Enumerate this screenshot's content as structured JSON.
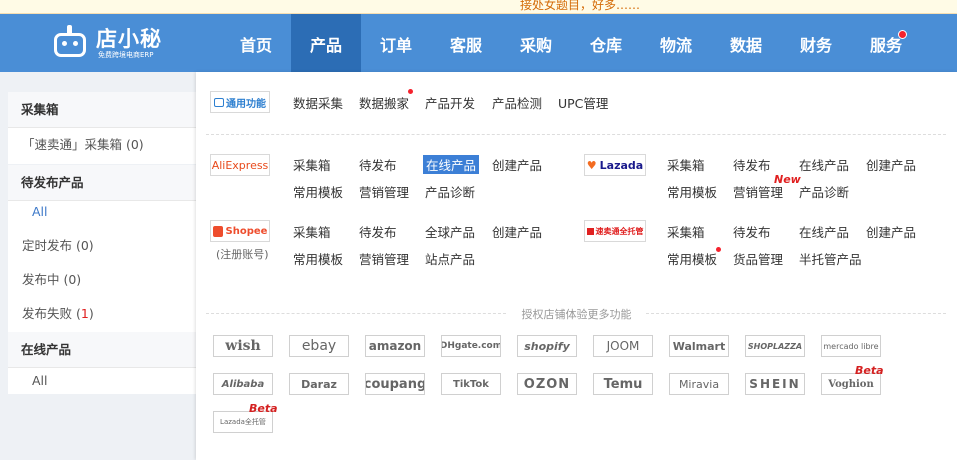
{
  "notice_text": "接处女题目，好多……",
  "brand": {
    "name": "店小秘",
    "tagline": "免费跨境电商ERP"
  },
  "nav": [
    {
      "label": "首页"
    },
    {
      "label": "产品",
      "active": true
    },
    {
      "label": "订单"
    },
    {
      "label": "客服"
    },
    {
      "label": "采购"
    },
    {
      "label": "仓库"
    },
    {
      "label": "物流"
    },
    {
      "label": "数据"
    },
    {
      "label": "财务"
    },
    {
      "label": "服务",
      "dot": true
    }
  ],
  "sidebar": {
    "collect": {
      "title": "采集箱",
      "rows": [
        "「速卖通」采集箱 (0)"
      ]
    },
    "pending": {
      "title": "待发布产品",
      "all": "All",
      "scheduled": "定时发布 (0)",
      "publishing": "发布中 (0)",
      "failed_prefix": "发布失败 (",
      "failed_count": "1",
      "failed_suffix": ")"
    },
    "online": {
      "title": "在线产品",
      "all": "All"
    }
  },
  "general": {
    "badge": "通用功能",
    "links": [
      "数据采集",
      "数据搬家",
      "产品开发",
      "产品检测",
      "UPC管理"
    ]
  },
  "aliexpress": {
    "badge": "AliExpress",
    "row1": [
      "采集箱",
      "待发布",
      "在线产品",
      "创建产品"
    ],
    "row2": [
      "常用模板",
      "营销管理",
      "产品诊断"
    ]
  },
  "lazada": {
    "badge": "Lazada",
    "row1": [
      "采集箱",
      "待发布",
      "在线产品",
      "创建产品"
    ],
    "row2": [
      "常用模板",
      "营销管理",
      "产品诊断"
    ],
    "new_tag": "New"
  },
  "shopee": {
    "badge": "Shopee",
    "register": "(注册账号)",
    "row1": [
      "采集箱",
      "待发布",
      "全球产品",
      "创建产品"
    ],
    "row2": [
      "常用模板",
      "营销管理",
      "站点产品"
    ]
  },
  "aliexpress_choice": {
    "badge": "速卖通全托管",
    "row1": [
      "采集箱",
      "待发布",
      "在线产品",
      "创建产品"
    ],
    "row2": [
      "常用模板",
      "货品管理",
      "半托管产品"
    ]
  },
  "more_title": "授权店铺体验更多功能",
  "platforms": [
    "wish",
    "ebay",
    "amazon",
    "DHgate.com",
    "shopify",
    "JOOM",
    "Walmart",
    "SHOPLAZZA",
    "mercado libre",
    "Alibaba",
    "Daraz",
    "coupang",
    "TikTok",
    "OZON",
    "Temu",
    "Miravia",
    "SHEIN",
    "Voghion",
    "Lazada全托管"
  ],
  "beta_label": "Beta",
  "colors": {
    "topbar": "#4a8ed6",
    "active_nav": "#2c6db5",
    "accent": "#3c7fd6",
    "alert": "#e02020"
  }
}
